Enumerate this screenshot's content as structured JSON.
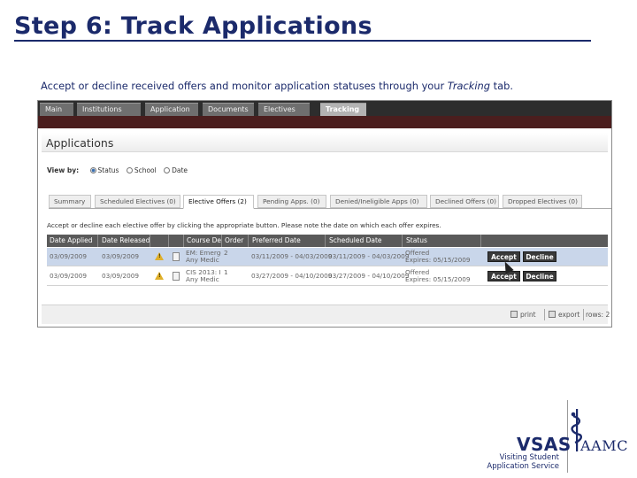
{
  "slide": {
    "title": "Step 6: Track Applications",
    "caption_before": "Accept or decline received offers and monitor application statuses through your ",
    "caption_em": "Tracking",
    "caption_after": " tab."
  },
  "app": {
    "nav_tabs": [
      "Main",
      "Institutions",
      "Application",
      "Documents",
      "Electives",
      "Tracking"
    ],
    "active_tab": "Tracking",
    "page_title": "Applications",
    "view_by": {
      "label": "View by:",
      "options": [
        "Status",
        "School",
        "Date"
      ],
      "selected": "Status"
    },
    "sub_tabs": [
      "Summary",
      "Scheduled Electives (0)",
      "Elective Offers (2)",
      "Pending Apps. (0)",
      "Denied/Ineligible Apps (0)",
      "Declined Offers (0)",
      "Dropped Electives (0)"
    ],
    "active_sub_tab": "Elective Offers (2)",
    "instruction": "Accept or decline each elective offer by clicking the appropriate button. Please note the date on which each offer expires.",
    "columns": [
      "Date Applied",
      "Date Released",
      "",
      "",
      "Course Desc",
      "Order",
      "Preferred Date",
      "Scheduled Date",
      "Status",
      ""
    ],
    "rows": [
      {
        "date_applied": "03/09/2009",
        "date_released": "03/09/2009",
        "course_line1": "EM: Emerger",
        "course_line2": "Any Medic",
        "order": "2",
        "preferred_date": "03/11/2009 - 04/03/2009",
        "scheduled_date": "03/11/2009 - 04/03/2009",
        "status_line1": "Offered",
        "status_line2": "Expires: 05/15/2009",
        "accept_label": "Accept",
        "decline_label": "Decline",
        "selected": true
      },
      {
        "date_applied": "03/09/2009",
        "date_released": "03/09/2009",
        "course_line1": "CIS 2013: I",
        "course_line2": "Any Medic",
        "order": "1",
        "preferred_date": "03/27/2009 - 04/10/2009",
        "scheduled_date": "03/27/2009 - 04/10/2009",
        "status_line1": "Offered",
        "status_line2": "Expires: 05/15/2009",
        "accept_label": "Accept",
        "decline_label": "Decline",
        "selected": false
      }
    ],
    "footer": {
      "print_label": "print",
      "export_label": "export",
      "rows_label": "rows: 2"
    }
  },
  "branding": {
    "vsas": "VSAS",
    "vsas_sub": [
      "Visiting Student",
      "Application Service"
    ],
    "aamc": "AAMC",
    "accent_color": "#1b2a6b"
  }
}
